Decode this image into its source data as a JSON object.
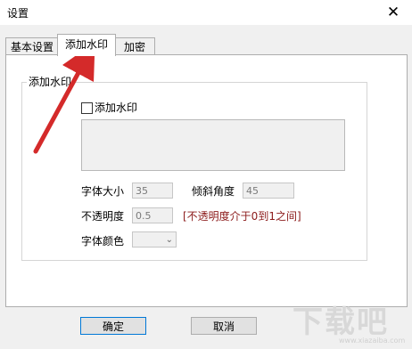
{
  "window": {
    "title": "设置",
    "close_glyph": "✕"
  },
  "tabs": [
    {
      "label": "基本设置",
      "active": false
    },
    {
      "label": "添加水印",
      "active": true
    },
    {
      "label": "加密",
      "active": false
    }
  ],
  "group": {
    "label": "添加水印"
  },
  "watermark": {
    "checkbox_label": "添加水印",
    "checked": false,
    "text_value": "",
    "font_size_label": "字体大小",
    "font_size_value": "35",
    "tilt_label": "倾斜角度",
    "tilt_value": "45",
    "opacity_label": "不透明度",
    "opacity_value": "0.5",
    "opacity_hint": "[不透明度介于0到1之间]",
    "font_color_label": "字体颜色"
  },
  "buttons": {
    "ok": "确定",
    "cancel": "取消"
  },
  "overlay": {
    "site_logo": "下载吧",
    "site_url": "www.xiazaiba.com"
  },
  "colors": {
    "arrow": "#d42a2a",
    "hint": "#8b1a1a"
  }
}
